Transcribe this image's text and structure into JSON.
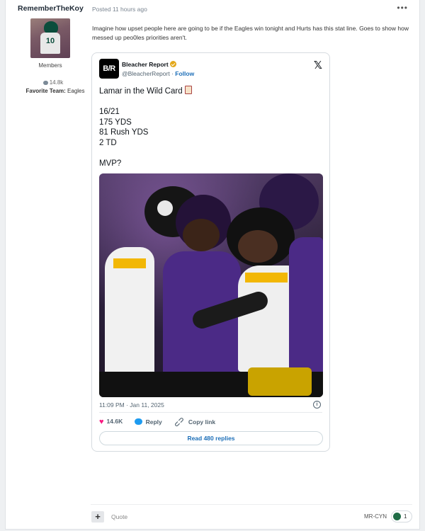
{
  "author": {
    "name": "RememberTheKoy",
    "group": "Members",
    "post_count": "14.8k",
    "favorite_team_label": "Favorite Team:",
    "favorite_team": "Eagles",
    "avatar_number": "10"
  },
  "post": {
    "posted": "Posted 11 hours ago",
    "more_icon": "ellipsis-icon",
    "text": "Imagine how upset people here are going to be if the Eagles win tonight and Hurts has this stat line.  Goes to show how messed up peo0les priorities aren't."
  },
  "tweet": {
    "logo_text": "B/R",
    "account_name": "Bleacher Report",
    "handle": "@BleacherReport",
    "separator": " · ",
    "follow_label": "Follow",
    "lines": [
      "Lamar in the Wild Card",
      "",
      "16/21",
      "175 YDS",
      "81 Rush YDS",
      "2 TD",
      "",
      "MVP?"
    ],
    "timestamp": "11:09 PM · Jan 11, 2025",
    "likes": "14.6K",
    "reply_label": "Reply",
    "copy_link_label": "Copy link",
    "read_replies_label": "Read 480 replies",
    "brand_color": "#1d6fb8",
    "like_color": "#f91880"
  },
  "footer": {
    "quote_label": "Quote",
    "reactor": "MR-CYN",
    "reaction_count": "1"
  }
}
